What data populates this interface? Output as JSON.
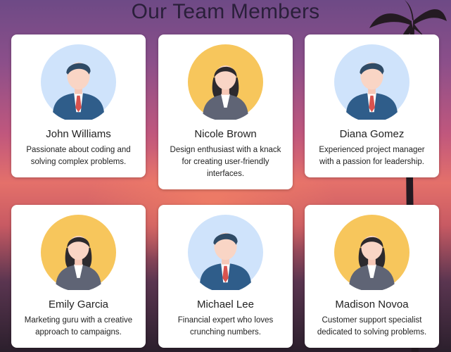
{
  "page": {
    "title": "Our Team Members"
  },
  "members": [
    {
      "name": "John Williams",
      "description": "Passionate about coding and solving complex problems.",
      "avatar": "male-avatar-icon"
    },
    {
      "name": "Nicole Brown",
      "description": "Design enthusiast with a knack for creating user-friendly interfaces.",
      "avatar": "female-avatar-icon"
    },
    {
      "name": "Diana Gomez",
      "description": "Experienced project manager with a passion for leadership.",
      "avatar": "male-avatar-icon"
    },
    {
      "name": "Emily Garcia",
      "description": "Marketing guru with a creative approach to campaigns.",
      "avatar": "female-avatar-icon"
    },
    {
      "name": "Michael Lee",
      "description": "Financial expert who loves crunching numbers.",
      "avatar": "male-avatar-icon"
    },
    {
      "name": "Madison Novoa",
      "description": "Customer support specialist dedicated to solving problems.",
      "avatar": "female-avatar-icon"
    }
  ],
  "colors": {
    "male_avatar_bg": "#cfe3fb",
    "female_avatar_bg": "#f7c65c",
    "card_bg": "#ffffff",
    "title_color": "#2a1f3a"
  }
}
